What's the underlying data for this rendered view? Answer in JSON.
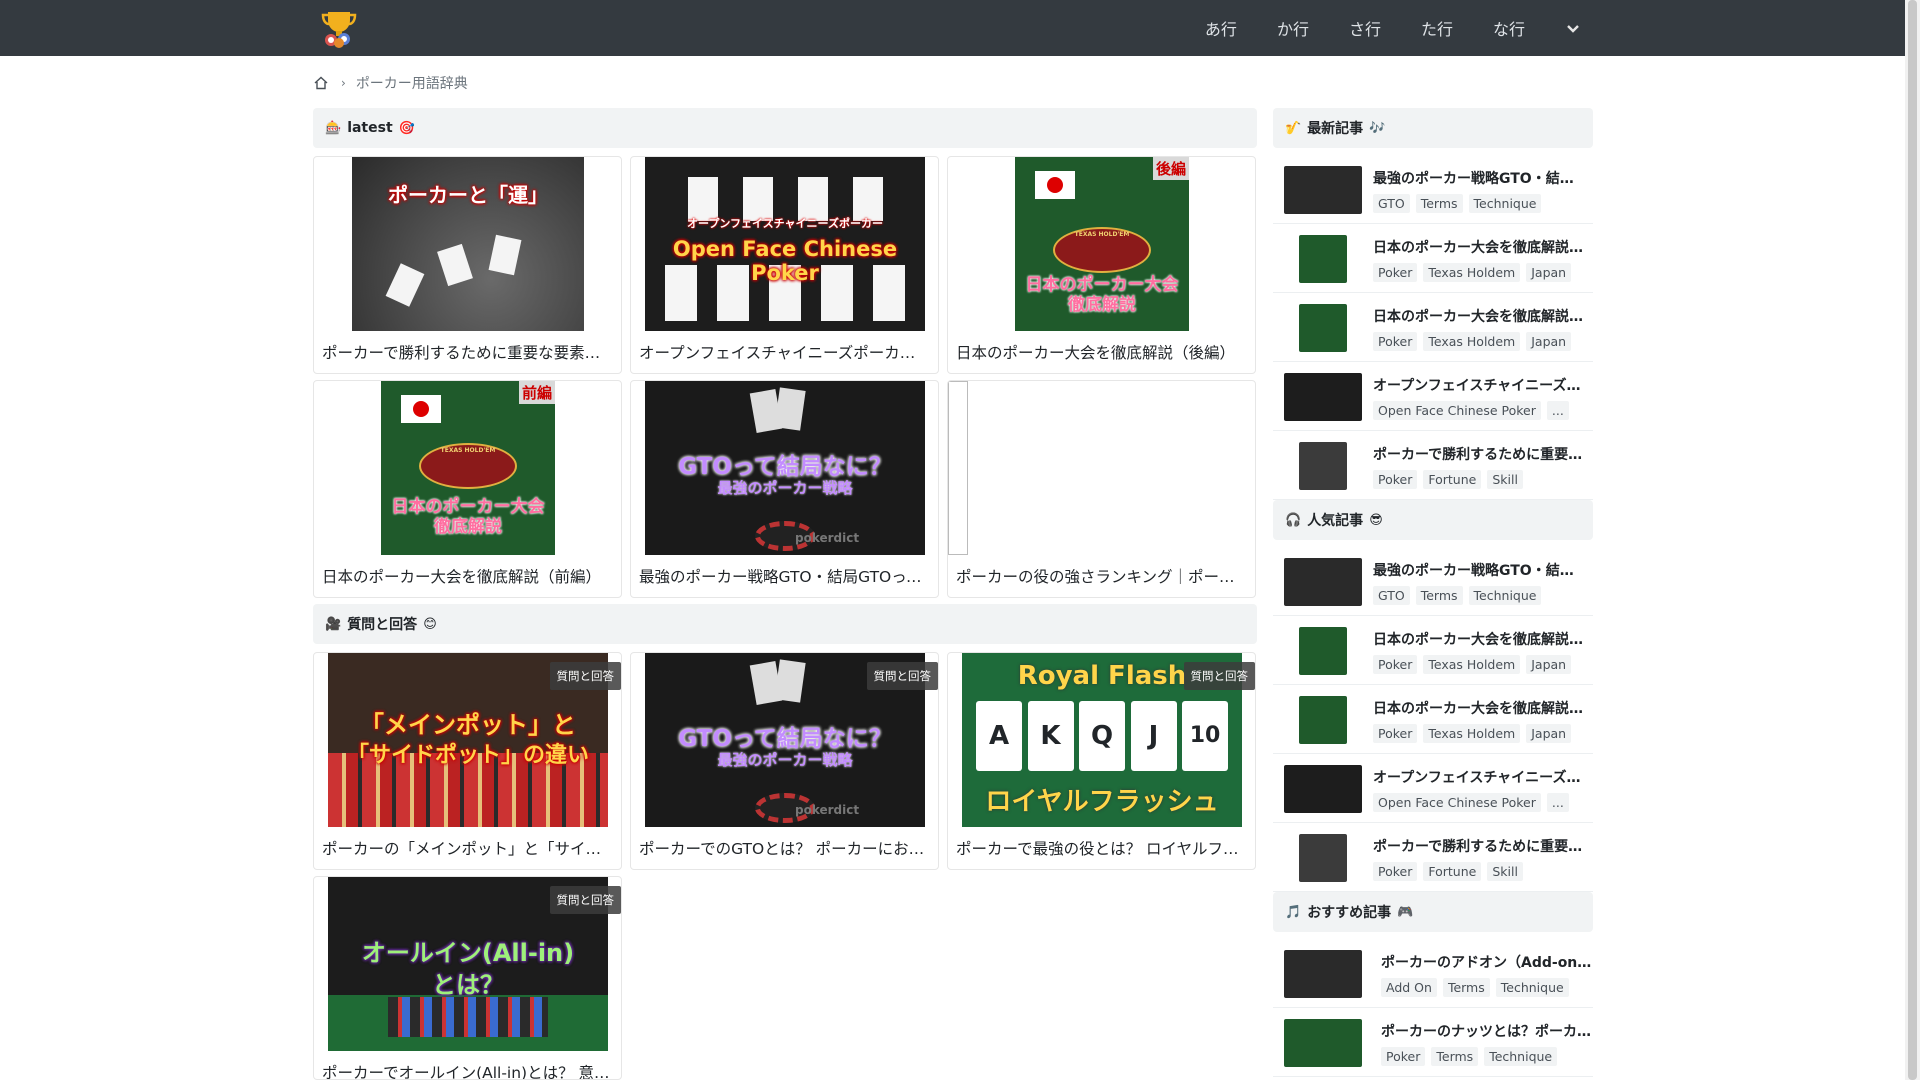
{
  "nav": {
    "items": [
      "あ行",
      "か行",
      "さ行",
      "た行",
      "な行"
    ]
  },
  "breadcrumb": {
    "current": "ポーカー用語辞典"
  },
  "sections": {
    "latest": {
      "emoji_left": "🎰",
      "title": "latest",
      "emoji_right": "🎯"
    },
    "qa": {
      "emoji_left": "🎥",
      "title": "質問と回答",
      "emoji_right": "😊"
    }
  },
  "latest_cards": [
    {
      "title": "ポーカーで勝利するために重要な要素とは？",
      "thumb_text": "ポーカーと「運」"
    },
    {
      "title": "オープンフェイスチャイニーズポーカー（OFC）とは？",
      "thumb_text_top": "オープンフェイスチャイニーズポーカー",
      "thumb_text": "Open Face Chinese Poker"
    },
    {
      "title": "日本のポーカー大会を徹底解説（後編）",
      "thumb_text": "日本のポーカー大会徹底解説",
      "corner": "後編",
      "logo": "TEXAS HOLD'EM"
    },
    {
      "title": "日本のポーカー大会を徹底解説（前編）",
      "thumb_text": "日本のポーカー大会徹底解説",
      "corner": "前編",
      "logo": "TEXAS HOLD'EM"
    },
    {
      "title": "最強のポーカー戦略GTO・結局GTOって何？",
      "thumb_text": "GTOって結局なに？",
      "thumb_sub": "最強のポーカー戦略",
      "watermark": "pokerdict"
    },
    {
      "title": "ポーカーの役の強さランキング｜ポーカー用語辞典"
    }
  ],
  "qa_cards": [
    {
      "title": "ポーカーの「メインポット」と「サイドポット」の違い",
      "badge": "質問と回答",
      "thumb_text_1": "「メインポット」と",
      "thumb_text_2": "「サイドポット」の違い"
    },
    {
      "title": "ポーカーでのGTOとは？ ポーカーにおける最強戦略",
      "badge": "質問と回答",
      "thumb_text": "GTOって結局なに？",
      "thumb_sub": "最強のポーカー戦略",
      "watermark": "pokerdict"
    },
    {
      "title": "ポーカーで最強の役とは？ ロイヤルフラッシュ",
      "badge": "質問と回答",
      "thumb_top": "Royal Flash",
      "cards": [
        "A",
        "K",
        "Q",
        "J",
        "10"
      ],
      "thumb_text": "ロイヤルフラッシュ"
    },
    {
      "title": "ポーカーでオールイン(All-in)とは？ 意味と使い方",
      "badge": "質問と回答",
      "thumb_text_1": "オールイン(All-in)",
      "thumb_text_2": "とは？"
    }
  ],
  "sidebar": {
    "latest": {
      "emoji_left": "🎷",
      "title": "最新記事",
      "emoji_right": "🎶",
      "items": [
        {
          "title": "最強のポーカー戦略GTO・結局GTOって何？",
          "tags": [
            "GTO",
            "Terms",
            "Technique"
          ]
        },
        {
          "title": "日本のポーカー大会を徹底解説（後編）",
          "tags": [
            "Poker",
            "Texas Holdem",
            "Japan"
          ]
        },
        {
          "title": "日本のポーカー大会を徹底解説（前編）",
          "tags": [
            "Poker",
            "Texas Holdem",
            "Japan"
          ]
        },
        {
          "title": "オープンフェイスチャイニーズポーカー",
          "tags": [
            "Open Face Chinese Poker",
            "..."
          ]
        },
        {
          "title": "ポーカーで勝利するために重要な要素",
          "tags": [
            "Poker",
            "Fortune",
            "Skill"
          ]
        }
      ]
    },
    "popular": {
      "emoji_left": "🎧",
      "title": "人気記事",
      "emoji_right": "😎",
      "items": [
        {
          "title": "最強のポーカー戦略GTO・結局GTOって何？",
          "tags": [
            "GTO",
            "Terms",
            "Technique"
          ]
        },
        {
          "title": "日本のポーカー大会を徹底解説（後編）",
          "tags": [
            "Poker",
            "Texas Holdem",
            "Japan"
          ]
        },
        {
          "title": "日本のポーカー大会を徹底解説（前編）",
          "tags": [
            "Poker",
            "Texas Holdem",
            "Japan"
          ]
        },
        {
          "title": "オープンフェイスチャイニーズポーカー",
          "tags": [
            "Open Face Chinese Poker",
            "..."
          ]
        },
        {
          "title": "ポーカーで勝利するために重要な要素",
          "tags": [
            "Poker",
            "Fortune",
            "Skill"
          ]
        }
      ]
    },
    "recommended": {
      "emoji_left": "🎵",
      "title": "おすすめ記事",
      "emoji_right": "🎮",
      "items": [
        {
          "title": "ポーカーのアドオン（Add-on）とは？",
          "tags": [
            "Add On",
            "Terms",
            "Technique"
          ]
        },
        {
          "title": "ポーカーのナッツとは？ポーカー用語",
          "tags": [
            "Poker",
            "Terms",
            "Technique"
          ]
        }
      ]
    }
  }
}
